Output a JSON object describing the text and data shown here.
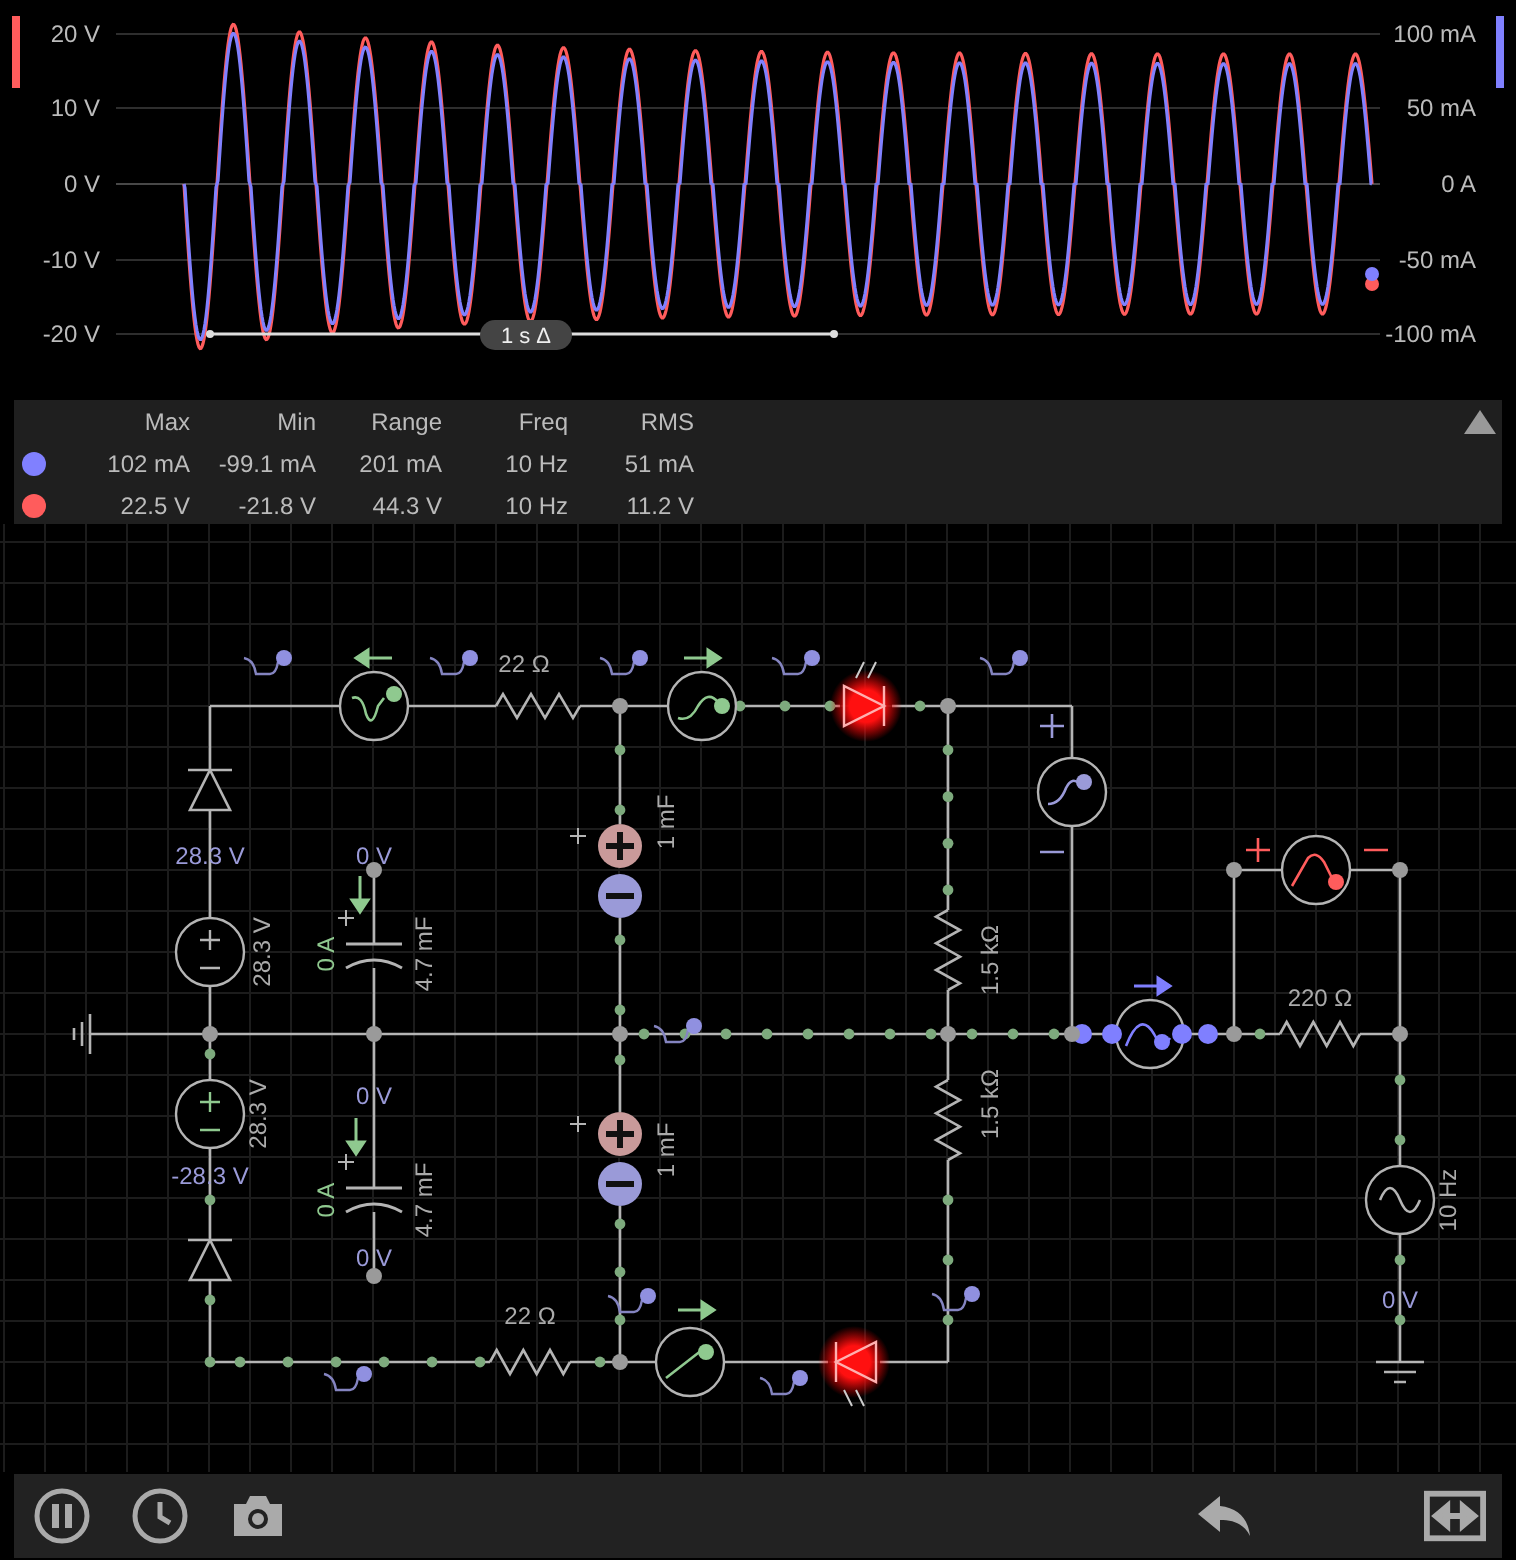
{
  "scope": {
    "left_ticks": [
      "20 V",
      "10 V",
      "0 V",
      "-10 V",
      "-20 V"
    ],
    "right_ticks": [
      "100 mA",
      "50 mA",
      "0 A",
      "-50 mA",
      "-100 mA"
    ],
    "traces": [
      {
        "color": "#ff5c5c"
      },
      {
        "color": "#8080ff"
      }
    ],
    "time_marker": "1 s Δ"
  },
  "measurements": {
    "columns": [
      "Max",
      "Min",
      "Range",
      "Freq",
      "RMS"
    ],
    "rows": [
      {
        "color": "#8080ff",
        "cells": [
          "102 mA",
          "-99.1 mA",
          "201 mA",
          "10 Hz",
          "51 mA"
        ]
      },
      {
        "color": "#ff5c5c",
        "cells": [
          "22.5 V",
          "-21.8 V",
          "44.3 V",
          "10 Hz",
          "11.2 V"
        ]
      }
    ]
  },
  "circuit": {
    "labels": [
      {
        "text": "22 Ω",
        "kind": "value"
      },
      {
        "text": "28.3 V",
        "kind": "voltage"
      },
      {
        "text": "0 V",
        "kind": "voltage"
      },
      {
        "text": "28.3 V",
        "kind": "value"
      },
      {
        "text": "0 A",
        "kind": "current"
      },
      {
        "text": "4.7 mF",
        "kind": "value"
      },
      {
        "text": "1 mF",
        "kind": "value"
      },
      {
        "text": "1.5 kΩ",
        "kind": "value"
      },
      {
        "text": "220 Ω",
        "kind": "value"
      },
      {
        "text": "0 V",
        "kind": "voltage"
      },
      {
        "text": "28.3 V",
        "kind": "value"
      },
      {
        "text": "-28.3 V",
        "kind": "voltage"
      },
      {
        "text": "0 A",
        "kind": "current"
      },
      {
        "text": "4.7 mF",
        "kind": "value"
      },
      {
        "text": "1 mF",
        "kind": "value"
      },
      {
        "text": "1.5 kΩ",
        "kind": "value"
      },
      {
        "text": "0 V",
        "kind": "voltage"
      },
      {
        "text": "10 Hz",
        "kind": "value"
      },
      {
        "text": "0 V",
        "kind": "voltage"
      },
      {
        "text": "22 Ω",
        "kind": "value"
      }
    ]
  }
}
